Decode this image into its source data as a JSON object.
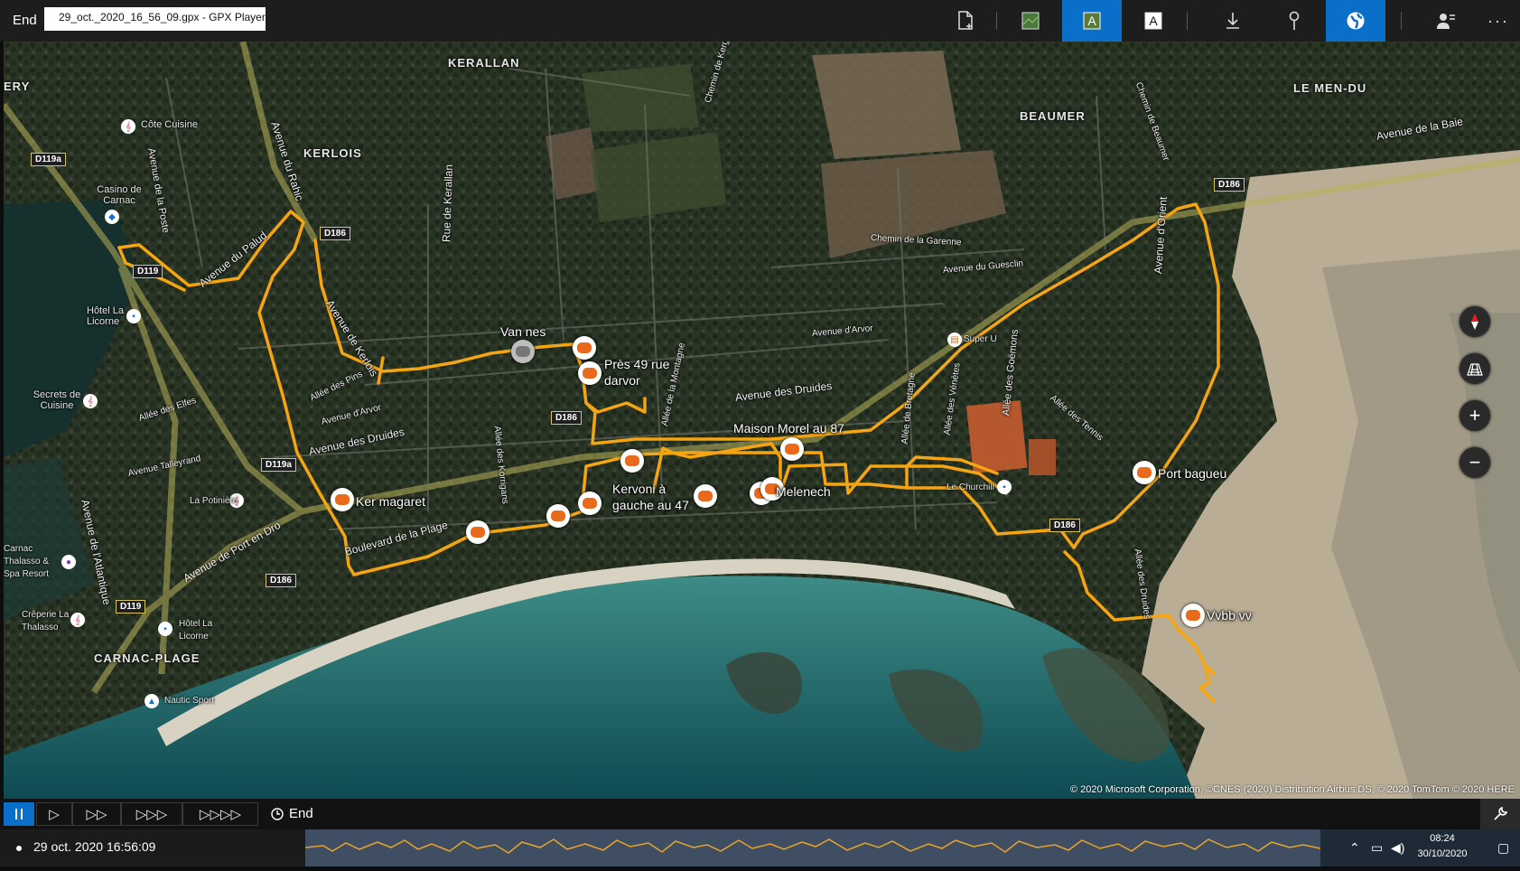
{
  "titlebar": {
    "end_label": "End",
    "file_tab": "29_oct._2020_16_56_09.gpx - GPX Player",
    "icons": [
      "new-file-icon",
      "satellite-icon",
      "labels-on-icon",
      "labels-off-icon",
      "download-icon",
      "pin-icon",
      "globe-icon",
      "person-icon",
      "more-icon"
    ]
  },
  "map": {
    "places": {
      "kerallan": "KERALLAN",
      "kerlois": "KERLOIS",
      "beaumer": "BEAUMER",
      "le_men_du": "LE MEN-DU",
      "ery": "ERY",
      "carnac_plage": "CARNAC-PLAGE"
    },
    "pois": {
      "cote_cuisine": "Côte Cuisine",
      "casino": "Casino de Carnac",
      "hotel_la_licorne_1": "Hôtel La Licorne",
      "secrets_de_cuisine": "Secrets de Cuisine",
      "la_potiniere": "La Potinière",
      "carnac_thalasso": "Carnac Thalasso & Spa Resort",
      "creperie": "Crêperie La Thalasso",
      "hotel_la_licorne_2": "Hôtel La Licorne",
      "nautic_sport": "Nautic Sport",
      "super_u": "Super U",
      "le_churchill": "Le Churchill"
    },
    "roads": {
      "avenue_du_palud": "Avenue du Palud",
      "avenue_du_rahic": "Avenue du Rahic",
      "avenue_de_kerlois": "Avenue de Kerlois",
      "rue_de_kerallan": "Rue de Kerallan",
      "avenue_des_druides_1": "Avenue des Druides",
      "avenue_des_druides_2": "Avenue des Druides",
      "avenue_d_arvor": "Avenue d'Arvor",
      "avenue_du_guesclin": "Avenue du Guesclin",
      "chemin_de_la_garenne": "Chemin de la Garenne",
      "avenue_de_la_baie": "Avenue de la Baie",
      "avenue_d_orient": "Avenue d'Orient",
      "boulevard_de_la_plage": "Boulevard de la Plage",
      "avenue_de_port_en_dro": "Avenue de Port en Dro",
      "avenue_de_l_atlantique": "Avenue de l'Atlantique",
      "avenue_de_la_poste": "Avenue de la Poste",
      "allee_des_pins": "Allée des Pins",
      "avenue_talleyrand": "Avenue Talleyrand",
      "avenue_d_arvor_2": "Avenue d'Arvor",
      "allee_des_elfes": "Allée des Elfes",
      "allee_de_la_montagne": "Allée de la Montagne",
      "allee_des_korrigans": "Allée des Korrigans",
      "allee_de_bretagne": "Allée de Bretagne",
      "allee_des_venetes": "Allée des Vénètes",
      "allee_des_goemons": "Allée des Goëmons",
      "allee_des_tennis": "Allée des Tennis",
      "allee_des_druides_s": "Allée des Druides",
      "chemin_de_beaumer": "Chemin de Beaumer",
      "chemin_de_kergouic": "Chemin de Kergouic"
    },
    "shields": {
      "d119a_1": "D119a",
      "d119": "D119",
      "d186_1": "D186",
      "d186_2": "D186",
      "d186_3": "D186",
      "d186_4": "D186",
      "d119a_2": "D119a",
      "d186_5": "D186",
      "d119_2": "D119"
    },
    "waypoints": {
      "van_nes": "Van nes",
      "pres_49": "Près 49 rue darvor",
      "maison_morel": "Maison Morel au 87",
      "kervoni": "Kervoni à gauche au 47",
      "melenech": "Melenech",
      "ker_magaret": "Ker magaret",
      "port_bagueu": "Port bagueu",
      "vvbb": "Vvbb vv"
    },
    "controls": [
      "compass-icon",
      "layers-icon",
      "zoom-in-icon",
      "zoom-out-icon"
    ],
    "copyright": "© 2020 Microsoft Corporation, ©CNES (2020) Distribution Airbus DS, © 2020 TomTom © 2020 HERE",
    "track_color": "#f5a512"
  },
  "playback": {
    "speeds": [
      "▷",
      "▷▷",
      "▷▷▷",
      "▷▷▷▷"
    ],
    "end_label": "End",
    "accent": "#0a6fc9"
  },
  "timeline": {
    "current_time": "29 oct. 2020 16:56:09"
  },
  "taskbar": {
    "time": "08:24",
    "date": "30/10/2020"
  }
}
